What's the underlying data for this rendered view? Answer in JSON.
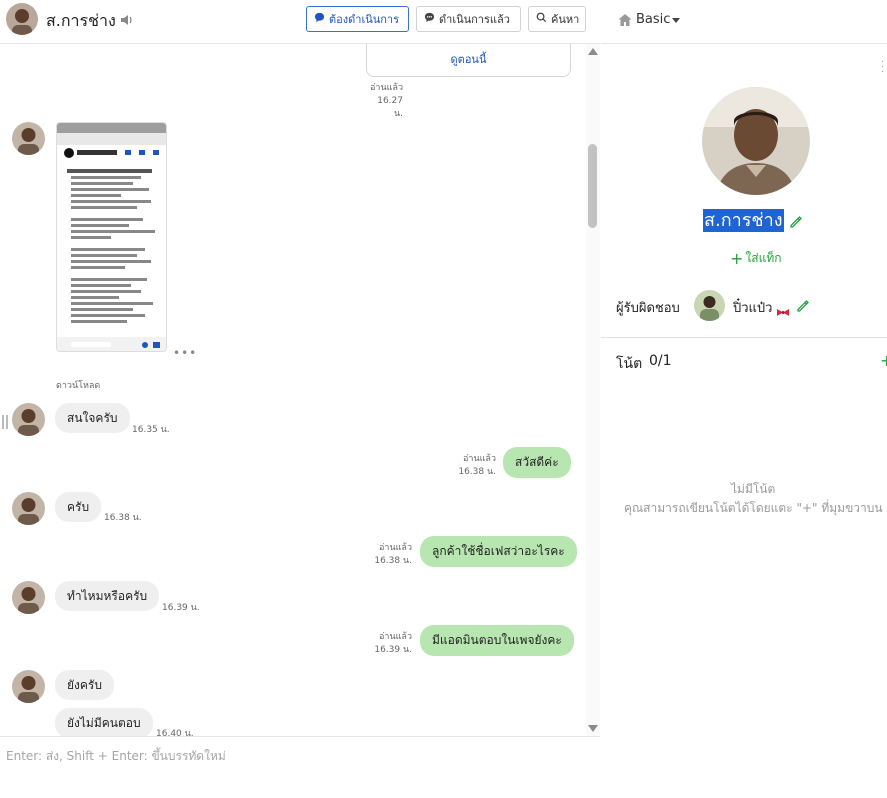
{
  "header": {
    "contact_name": "ส.การช่าง",
    "todo_label": "ต้องดำเนินการ",
    "done_label": "ดำเนินการแล้ว",
    "search_label": "ค้นหา"
  },
  "chat": {
    "card_link": "ดูตอนนี้",
    "messages": [
      {
        "side": "out",
        "read": "อ่านแล้ว",
        "time": "16.27 น."
      },
      {
        "side": "in",
        "type": "image",
        "caption": "ดาวน์โหลด"
      },
      {
        "side": "in",
        "text": "สนใจครับ",
        "time": "16.35 น."
      },
      {
        "side": "out",
        "text": "สวัสดีค่ะ",
        "read": "อ่านแล้ว",
        "time": "16.38 น."
      },
      {
        "side": "in",
        "text": "ครับ",
        "time": "16.38 น."
      },
      {
        "side": "out",
        "text": "ลูกค้าใช้ชื่อเฟสว่าอะไรคะ",
        "read": "อ่านแล้ว",
        "time": "16.38 น."
      },
      {
        "side": "in",
        "text": "ทำไหมหรือครับ",
        "time": "16.39 น."
      },
      {
        "side": "out",
        "text": "มีแอดมินตอบในเพจยังคะ",
        "read": "อ่านแล้ว",
        "time": "16.39 น."
      },
      {
        "side": "in",
        "text": "ยังครับ"
      },
      {
        "side": "in",
        "text": "ยังไม่มีคนตอบ",
        "time": "16.40 น."
      }
    ]
  },
  "composer": {
    "placeholder": "Enter: ส่ง, Shift + Enter: ขึ้นบรรทัดใหม่"
  },
  "side": {
    "plan_label": "Basic",
    "profile_name": "ส.การช่าง",
    "add_tag_label": "ใส่แท็ก",
    "responsible_label": "ผู้รับผิดชอบ",
    "responsible_name": "ปิ๋วแป๋ว",
    "notes_label": "โน้ต",
    "notes_count": "0/1",
    "empty_title": "ไม่มีโน้ต",
    "empty_hint": "คุณสามารถเขียนโน้ตได้โดยแตะ \"+\" ที่มุมขวาบน"
  },
  "colors": {
    "outgoing_bubble": "#b7e6b0",
    "incoming_bubble": "#efefef",
    "accent_blue": "#1f55c0",
    "accent_green": "#23a23c"
  },
  "icons": [
    "speaker-icon",
    "chat-bubble-icon",
    "search-icon",
    "home-icon",
    "pencil-icon",
    "plus-icon",
    "bow-icon",
    "avatar-icon"
  ]
}
